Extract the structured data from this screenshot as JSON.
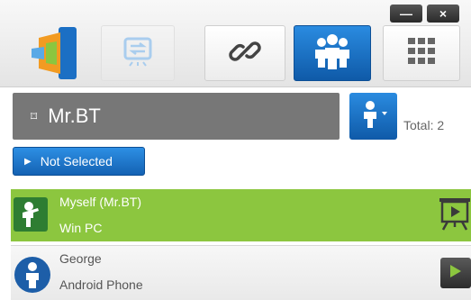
{
  "window": {
    "minimize_label": "—",
    "close_label": "×"
  },
  "toolbar": {
    "icons": [
      "app-logo-icon",
      "screen-swap-icon",
      "link-icon",
      "group-icon",
      "grid-icon"
    ],
    "active_tab": "group",
    "colors": {
      "active": "#1a72c8",
      "disabled": "#e9e9e9"
    }
  },
  "session": {
    "pin_glyph": "⌑",
    "name": "Mr.BT",
    "total_label": "Total: 2",
    "filter_label": "Not Selected"
  },
  "devices": [
    {
      "name": "Myself (Mr.BT)",
      "platform": "Win PC",
      "selected": true,
      "action_icon": "present-screen-icon",
      "color": "#8cc63f"
    },
    {
      "name": "George",
      "platform": "Android Phone",
      "selected": false,
      "action_icon": "play-icon",
      "color": "#1d5ea8"
    }
  ]
}
